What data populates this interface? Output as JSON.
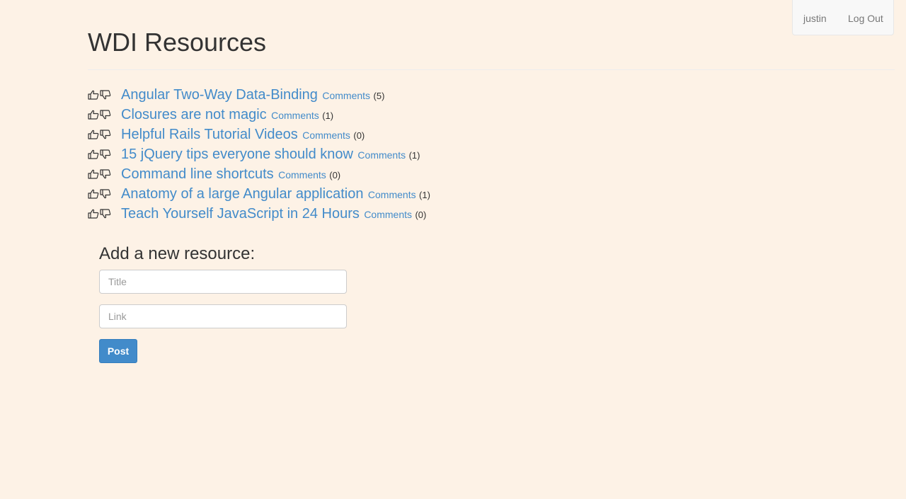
{
  "nav": {
    "user": "justin",
    "logout": "Log Out"
  },
  "page": {
    "title": "WDI Resources"
  },
  "resources": [
    {
      "title": "Angular Two-Way Data-Binding",
      "comments_label": "Comments",
      "count": "(5)"
    },
    {
      "title": "Closures are not magic",
      "comments_label": "Comments",
      "count": "(1)"
    },
    {
      "title": "Helpful Rails Tutorial Videos",
      "comments_label": "Comments",
      "count": "(0)"
    },
    {
      "title": "15 jQuery tips everyone should know",
      "comments_label": "Comments",
      "count": "(1)"
    },
    {
      "title": "Command line shortcuts",
      "comments_label": "Comments",
      "count": "(0)"
    },
    {
      "title": "Anatomy of a large Angular application",
      "comments_label": "Comments",
      "count": "(1)"
    },
    {
      "title": "Teach Yourself JavaScript in 24 Hours",
      "comments_label": "Comments",
      "count": "(0)"
    }
  ],
  "form": {
    "heading": "Add a new resource:",
    "title_placeholder": "Title",
    "link_placeholder": "Link",
    "post_label": "Post"
  },
  "icons": {
    "upvote": "thumbs-up-icon",
    "downvote": "thumbs-down-icon"
  },
  "colors": {
    "background": "#fdf2e6",
    "link": "#428bca",
    "button": "#428bca",
    "text": "#333333"
  }
}
